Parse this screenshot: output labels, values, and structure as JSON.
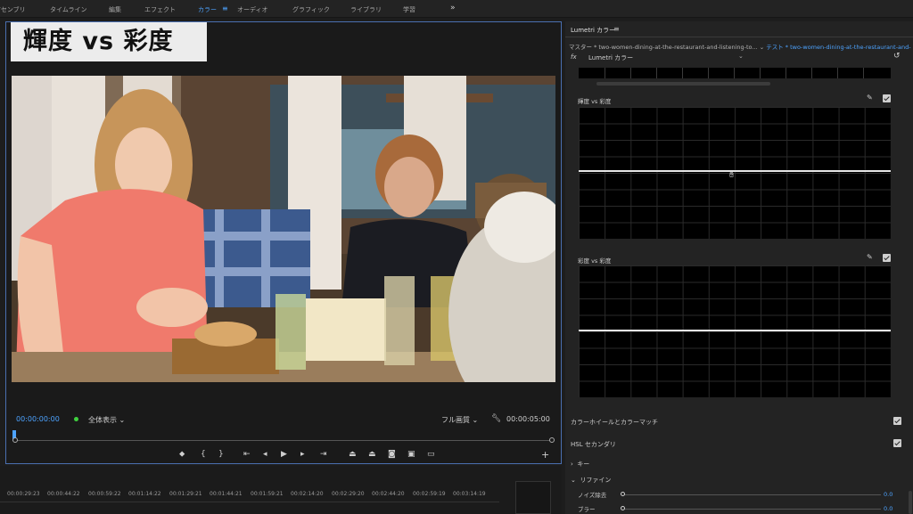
{
  "workspaces": [
    "アセンブリ",
    "タイムライン",
    "編集",
    "エフェクト",
    "カラー",
    "オーディオ",
    "グラフィック",
    "ライブラリ",
    "学習"
  ],
  "workspace_active": "カラー",
  "workspace_menu_icon": "≡",
  "workspace_overflow": "»",
  "overlay_title": "輝度 vs 彩度",
  "program": {
    "timecode_current": "00:00:00:00",
    "zoom": "全体表示",
    "resolution": "フル画質",
    "timecode_duration": "00:00:05:00",
    "transport_icons": [
      "marker-icon",
      "in-point-icon",
      "out-point-icon",
      "go-to-in-icon",
      "step-back-icon",
      "play-icon",
      "step-forward-icon",
      "go-to-out-icon",
      "lift-icon",
      "extract-icon",
      "export-frame-icon",
      "button-editor-icon",
      "comparison-view-icon"
    ],
    "add_label": "+"
  },
  "timeline_ticks": [
    "00:00:29:23",
    "00:00:44:22",
    "00:00:59:22",
    "00:01:14:22",
    "00:01:29:21",
    "00:01:44:21",
    "00:01:59:21",
    "00:02:14:20",
    "00:02:29:20",
    "00:02:44:20",
    "00:02:59:19",
    "00:03:14:19"
  ],
  "lumetri": {
    "title": "Lumetri カラー",
    "menu_icon": "≡",
    "master_label": "マスター * two-women-dining-at-the-restaurant-and-listening-to...",
    "target_label": "テスト * two-women-dining-at-the-restaurant-and-listening-to...",
    "fx_label": "fx",
    "fx_name": "Lumetri カラー",
    "curve1_label": "輝度 vs 彩度",
    "curve2_label": "彩度 vs 彩度",
    "sections": {
      "color_wheels": "カラーホイールとカラーマッチ",
      "hsl": "HSL セカンダリ",
      "key": "キー",
      "refine": "リファイン"
    },
    "sliders": [
      {
        "label": "ノイズ除去",
        "value": "0.0",
        "level": 0.0
      },
      {
        "label": "ブラー",
        "value": "0.0",
        "level": 0.0
      }
    ]
  }
}
